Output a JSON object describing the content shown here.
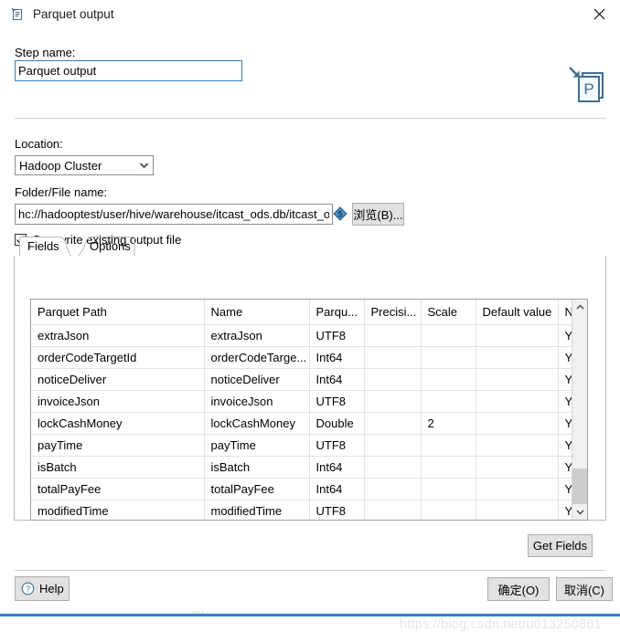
{
  "window": {
    "title": "Parquet output",
    "icon": "parquet-step-icon",
    "close_icon": "close-icon"
  },
  "logo": {
    "name": "parquet-output-logo",
    "letter": "P"
  },
  "form": {
    "step_name_label": "Step name:",
    "step_name_value": "Parquet output",
    "location_label": "Location:",
    "location_value": "Hadoop Cluster",
    "location_options": [
      "Hadoop Cluster"
    ],
    "folder_label": "Folder/File name:",
    "folder_value": "hc://hadooptest/user/hive/warehouse/itcast_ods.db/itcast_o",
    "variable_icon": "variable-diamond-icon",
    "browse_label": "浏览(B)...",
    "overwrite_label": "Overwrite existing output file",
    "overwrite_checked": true
  },
  "tabs": [
    {
      "label": "Fields",
      "selected": true
    },
    {
      "label": "Options",
      "selected": false
    }
  ],
  "table": {
    "columns": [
      "Parquet Path",
      "Name",
      "Parqu...",
      "Precisi...",
      "Scale",
      "Default value",
      "N"
    ],
    "rows": [
      {
        "path": "extraJson",
        "name": "extraJson",
        "type": "UTF8",
        "precision": "",
        "scale": "",
        "default": "",
        "nullable": "Y."
      },
      {
        "path": "orderCodeTargetId",
        "name": "orderCodeTarge...",
        "type": "Int64",
        "precision": "",
        "scale": "",
        "default": "",
        "nullable": "Y."
      },
      {
        "path": "noticeDeliver",
        "name": "noticeDeliver",
        "type": "Int64",
        "precision": "",
        "scale": "",
        "default": "",
        "nullable": "Y."
      },
      {
        "path": "invoiceJson",
        "name": "invoiceJson",
        "type": "UTF8",
        "precision": "",
        "scale": "",
        "default": "",
        "nullable": "Y."
      },
      {
        "path": "lockCashMoney",
        "name": "lockCashMoney",
        "type": "Double",
        "precision": "",
        "scale": "2",
        "default": "",
        "nullable": "Y."
      },
      {
        "path": "payTime",
        "name": "payTime",
        "type": "UTF8",
        "precision": "",
        "scale": "",
        "default": "",
        "nullable": "Y."
      },
      {
        "path": "isBatch",
        "name": "isBatch",
        "type": "Int64",
        "precision": "",
        "scale": "",
        "default": "",
        "nullable": "Y."
      },
      {
        "path": "totalPayFee",
        "name": "totalPayFee",
        "type": "Int64",
        "precision": "",
        "scale": "",
        "default": "",
        "nullable": "Y."
      },
      {
        "path": "modifiedTime",
        "name": "modifiedTime",
        "type": "UTF8",
        "precision": "",
        "scale": "",
        "default": "",
        "nullable": "Y."
      },
      {
        "path": "",
        "name": "",
        "type": "",
        "precision": "",
        "scale": "",
        "default": "",
        "nullable": ""
      },
      {
        "path": "",
        "name": "",
        "type": "",
        "precision": "",
        "scale": "",
        "default": "",
        "nullable": ""
      }
    ],
    "scrollbar": {
      "up_icon": "chevron-up-icon",
      "down_icon": "chevron-down-icon"
    }
  },
  "buttons": {
    "get_fields": "Get Fields",
    "help": "Help",
    "help_icon": "question-circle-icon",
    "ok": "确定(O)",
    "cancel": "取消(C)"
  },
  "watermark": "https://blog.csdn.net/u013250861",
  "colors": {
    "focus_border": "#3c7fb1",
    "button_face": "#e1e1e1",
    "logo_blue": "#3f6f8f",
    "accent_bar": "#2f7fd1"
  }
}
